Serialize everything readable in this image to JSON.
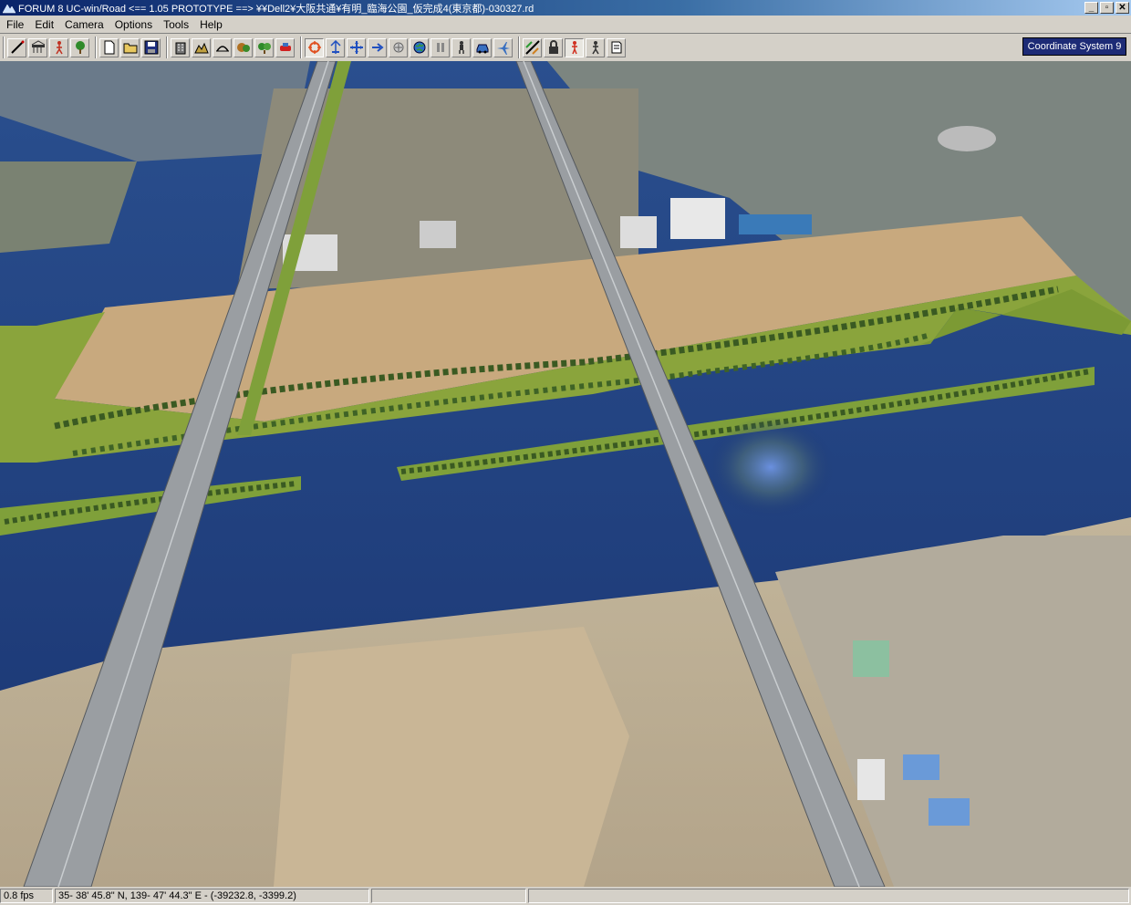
{
  "window": {
    "title": "FORUM 8    UC-win/Road    <== 1.05 PROTOTYPE ==>    ¥¥Dell2¥大阪共通¥有明_臨海公園_仮完成4(東京都)-030327.rd",
    "controls": {
      "minimize": "_",
      "restore": "▫",
      "close": "✕"
    }
  },
  "menu": {
    "items": [
      {
        "label": "File"
      },
      {
        "label": "Edit"
      },
      {
        "label": "Camera"
      },
      {
        "label": "Options"
      },
      {
        "label": "Tools"
      },
      {
        "label": "Help"
      }
    ]
  },
  "toolbar": {
    "groups": [
      [
        "road-edit-icon",
        "bridge-icon",
        "person-icon",
        "tree-icon"
      ],
      [
        "new-file-icon",
        "open-folder-icon",
        "save-icon"
      ],
      [
        "building-icon",
        "terrain-icon",
        "tunnel-icon",
        "landscape-icon",
        "vegetation-icon",
        "vehicle-model-icon"
      ],
      [
        "rotate-icon",
        "pan-icon",
        "move-icon",
        "arrow-right-icon",
        "zoom-icon",
        "globe-icon",
        "pause-icon",
        "driver-icon",
        "car-icon",
        "airplane-icon"
      ],
      [
        "ruler-icon",
        "lock-icon",
        "walk-red-icon",
        "walk-icon",
        "document-icon"
      ]
    ],
    "coordinate_button": "Coordinate System 9"
  },
  "status": {
    "fps": "0.8 fps",
    "position": "35- 38' 45.8\" N, 139- 47' 44.3\" E  -  (-39232.8, -3399.2)",
    "panel3": "",
    "panel4": ""
  },
  "colors": {
    "water": "#1e3d7c",
    "land": "#c8a97e",
    "park": "#8aa43c",
    "road": "#8e9296",
    "title_bar": "#0a246a",
    "coord_button": "#1d2b76"
  }
}
